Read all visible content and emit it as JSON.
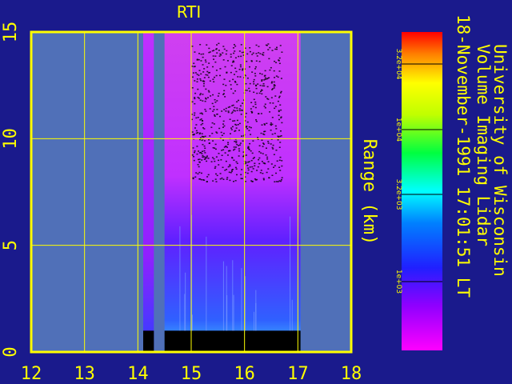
{
  "chart_data": {
    "type": "heatmap",
    "title": "RTI",
    "ylabel": "Range (km)",
    "xlim": [
      12,
      18
    ],
    "ylim": [
      0,
      15
    ],
    "x_ticks": [
      "12",
      "13",
      "14",
      "15",
      "16",
      "17",
      "18"
    ],
    "y_ticks": [
      "0",
      "5",
      "10",
      "15"
    ],
    "grid": true,
    "data_segments": [
      {
        "x_start": 14.1,
        "x_end": 14.3,
        "top_km": 15,
        "ground_echo_km": 1.0
      },
      {
        "x_start": 14.5,
        "x_end": 17.05,
        "top_km": 15,
        "ground_echo_km": 1.0
      }
    ],
    "colorbar": {
      "ticks": [
        "3.2e+04",
        "1e+04",
        "3.2e+03",
        "1e+03"
      ],
      "colors": [
        "#ff0000",
        "#ffa500",
        "#ffff00",
        "#00ff00",
        "#00ffff",
        "#0000ff",
        "#7f00ff",
        "#ff00ff"
      ]
    },
    "side_text": [
      "University of Wisconsin",
      "Volume Imaging Lidar",
      "18-November-1991 17:01:51 LT"
    ]
  },
  "colors": {
    "background": "#1a1a8c",
    "plot_bg": "#5070b8",
    "axis": "#ffff00"
  }
}
